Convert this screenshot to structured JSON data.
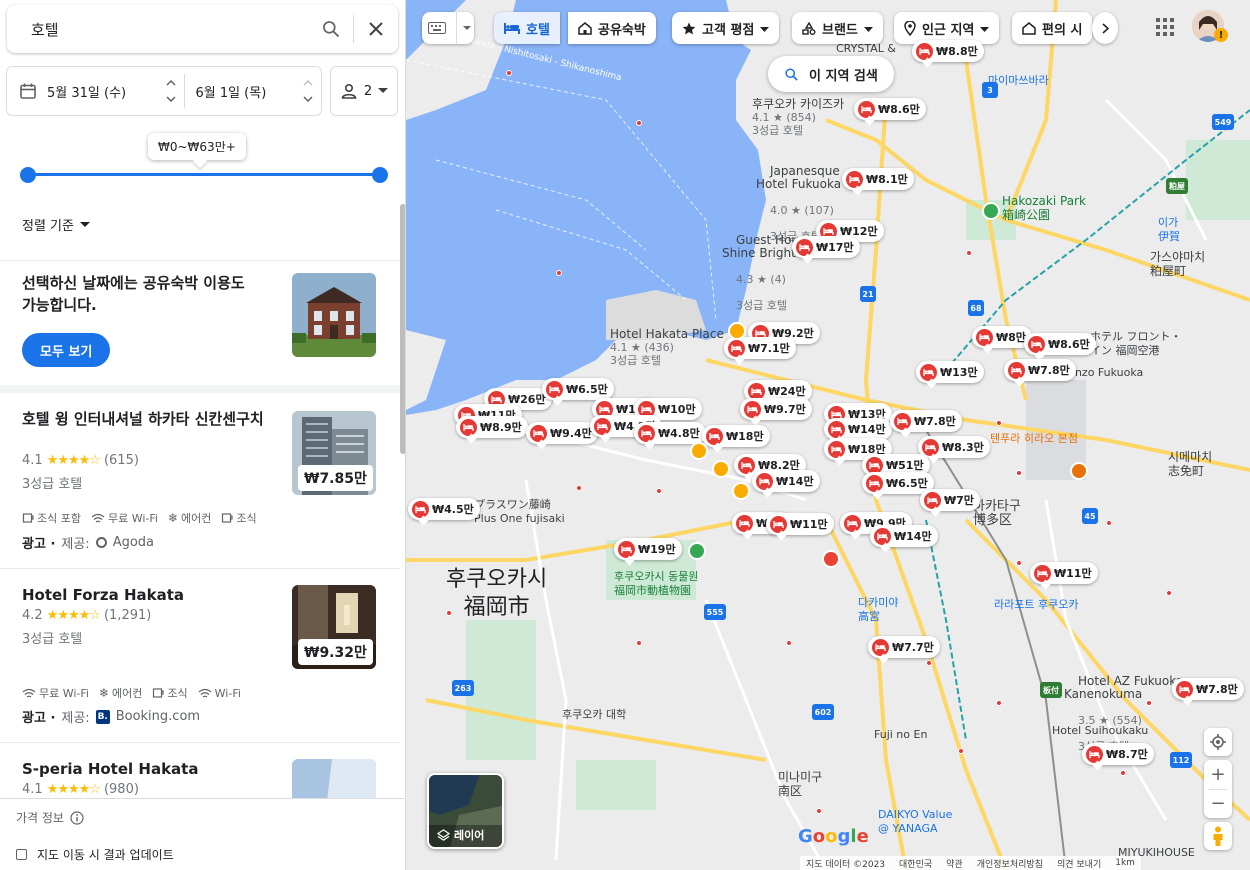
{
  "search": {
    "query": "호텔"
  },
  "dates": {
    "checkin": "5월 31일 (수)",
    "checkout": "6월 1일 (목)",
    "guests": "2"
  },
  "price_filter": {
    "label": "₩0~₩63만+",
    "min_fraction": 0,
    "max_fraction": 1
  },
  "sort": {
    "label": "정렬 기준"
  },
  "promo": {
    "text": "선택하신 날짜에는 공유숙박 이용도 가능합니다.",
    "button": "모두 보기"
  },
  "hotels": [
    {
      "name": "호텔 윙 인터내셔널 하카타 신칸센구치",
      "rating": "4.1",
      "stars": "★★★★☆",
      "reviews": "(615)",
      "class": "3성급 호텔",
      "amenities": [
        "조식 포함",
        "무료 Wi-Fi",
        "에어컨",
        "조식"
      ],
      "ad": "광고 ·",
      "provider_label": "제공:",
      "provider": "Agoda",
      "price": "₩7.85만"
    },
    {
      "name": "Hotel Forza Hakata",
      "rating": "4.2",
      "stars": "★★★★☆",
      "reviews": "(1,291)",
      "class": "3성급 호텔",
      "amenities": [
        "무료 Wi-Fi",
        "에어컨",
        "조식",
        "Wi-Fi"
      ],
      "ad": "광고 ·",
      "provider_label": "제공:",
      "provider": "Booking.com",
      "price": "₩9.32만"
    },
    {
      "name": "S-peria Hotel Hakata",
      "rating": "4.1",
      "stars": "★★★★☆",
      "reviews": "(980)"
    }
  ],
  "footer": {
    "price_info": "가격 정보",
    "update_on_move": "지도 이동 시 결과 업데이트"
  },
  "map": {
    "chips": [
      {
        "label": "호텔",
        "icon": "bed-icon",
        "selected": true
      },
      {
        "label": "공유숙박",
        "icon": "home-icon"
      },
      {
        "label": "고객 평점",
        "icon": "star-icon"
      },
      {
        "label": "브랜드",
        "icon": "brand-icon"
      },
      {
        "label": "인근 지역",
        "icon": "place-icon"
      },
      {
        "label": "편의 시",
        "icon": "amenity-icon"
      }
    ],
    "search_this_area": "이 지역 검색",
    "layer_label": "레이어",
    "pins": [
      {
        "price": "₩8.8만"
      },
      {
        "price": "₩8.6만"
      },
      {
        "price": "₩8.1만"
      },
      {
        "price": "₩12만"
      },
      {
        "price": "₩17만"
      },
      {
        "price": "₩9.2만"
      },
      {
        "price": "₩7.1만"
      },
      {
        "price": "₩8만"
      },
      {
        "price": "₩8.6만"
      },
      {
        "price": "₩13만"
      },
      {
        "price": "₩7.8만"
      },
      {
        "price": "₩26만"
      },
      {
        "price": "₩6.5만"
      },
      {
        "price": "₩24만"
      },
      {
        "price": "₩11만"
      },
      {
        "price": "₩8.9만"
      },
      {
        "price": "₩13만"
      },
      {
        "price": "₩10만"
      },
      {
        "price": "₩9.7만"
      },
      {
        "price": "₩9.4만"
      },
      {
        "price": "₩4.2만"
      },
      {
        "price": "₩4.8만"
      },
      {
        "price": "₩18만"
      },
      {
        "price": "₩13만"
      },
      {
        "price": "₩14만"
      },
      {
        "price": "₩7.8만"
      },
      {
        "price": "₩8.3만"
      },
      {
        "price": "₩18만"
      },
      {
        "price": "₩8.2만"
      },
      {
        "price": "₩51만"
      },
      {
        "price": "₩14만"
      },
      {
        "price": "₩6.5만"
      },
      {
        "price": "₩4.5만"
      },
      {
        "price": "₩7만"
      },
      {
        "price": "₩8만"
      },
      {
        "price": "₩11만"
      },
      {
        "price": "₩9.9만"
      },
      {
        "price": "₩14만"
      },
      {
        "price": "₩19만"
      },
      {
        "price": "₩11만"
      },
      {
        "price": "₩7.7만"
      },
      {
        "price": "₩7.8만"
      },
      {
        "price": "₩8.7만"
      }
    ],
    "hotel_labels": [
      {
        "name": "후쿠오카 카이즈카",
        "rating": "4.1 ★ (854)",
        "class": "3성급 호텔"
      },
      {
        "name": "Japanesque\nHotel Fukuoka",
        "rating": "4.0 ★ (107)",
        "class": "3성급 호텔"
      },
      {
        "name": "Guest House\nShine Bright",
        "rating": "4.3 ★ (4)",
        "class": "3성급 호텔"
      },
      {
        "name": "Hotel Hakata Place",
        "rating": "4.1 ★ (436)",
        "class": "3성급 호텔"
      },
      {
        "name": "Hotel AZ Fukuoka\nKanenokuma",
        "rating": "3.5 ★ (554)",
        "class": "3성급 호텔"
      }
    ],
    "places": {
      "fukuoka_kr": "후쿠오카시",
      "fukuoka_jp": "福岡市",
      "hakata_kr": "하카타구",
      "hakata_jp": "博多区",
      "hakozaki": "Hakozaki Park",
      "hakozaki_jp": "箱崎公園",
      "zoo": "후쿠오카시 동물원",
      "zoo_jp": "福岡市動植物園",
      "plus_one": "プラスワン藤崎\nPlus One fujisaki",
      "minami": "미나미구\n南区",
      "enzo": "Enzo Fukuoka",
      "hotel_front": "ホテル フロント・\nイン 福岡空港",
      "shime": "시메마치\n志免町",
      "kasuya": "가스야마치\n粕屋町",
      "tempura": "텐푸라 히라오 본점",
      "lalaport": "라라포트 후쿠오카",
      "suihoukaku": "Hotel Suihoukaku",
      "fuji": "Fuji no En",
      "daikyo": "DAIKYO Value\n@ YANAGA",
      "miyukihouse": "MIYUKIHOUSE",
      "univ": "후쿠오카 대학",
      "hakata_bay": "Hakata - Nishitosaki - Shikanoshima",
      "crystal": "CRYSTAL &",
      "marinomesse": "마이마쓰바라",
      "ijiri": "이가\n伊賀",
      "takamiya": "다카미야\n高宮"
    },
    "attribution": [
      "지도 데이터 ©2023",
      "대한민국",
      "약관",
      "개인정보처리방침",
      "의견 보내기",
      "1km"
    ]
  }
}
